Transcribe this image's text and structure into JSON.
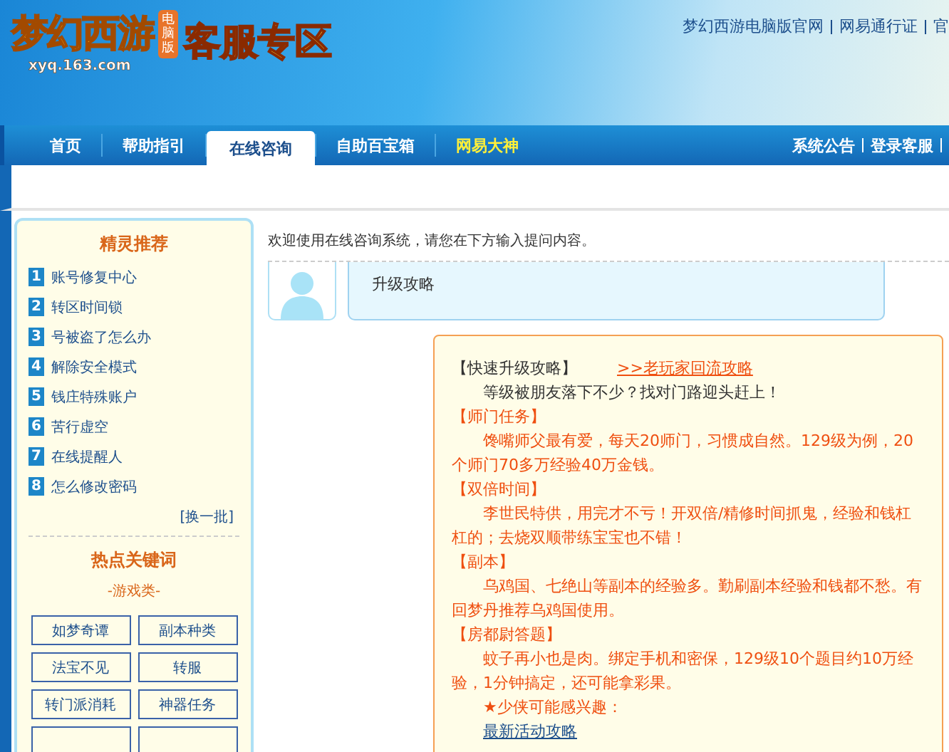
{
  "header": {
    "logo": {
      "name": "梦幻西游",
      "edition": "电脑版",
      "domain": "xyq.163.com"
    },
    "title": "客服专区",
    "links": [
      "梦幻西游电脑版官网",
      "网易通行证",
      "官"
    ]
  },
  "nav": {
    "tabs": [
      {
        "label": "首页",
        "selected": false,
        "kind": "normal"
      },
      {
        "label": "帮助指引",
        "selected": false,
        "kind": "normal"
      },
      {
        "label": "在线咨询",
        "selected": true,
        "kind": "normal"
      },
      {
        "label": "自助百宝箱",
        "selected": false,
        "kind": "normal"
      },
      {
        "label": "网易大神",
        "selected": false,
        "kind": "highlight"
      }
    ],
    "links": [
      "系统公告",
      "登录客服"
    ]
  },
  "sidebar": {
    "title": "精灵推荐",
    "items": [
      {
        "number": "1",
        "label": "账号修复中心"
      },
      {
        "number": "2",
        "label": "转区时间锁"
      },
      {
        "number": "3",
        "label": "号被盗了怎么办"
      },
      {
        "number": "4",
        "label": "解除安全模式"
      },
      {
        "number": "5",
        "label": "钱庄特殊账户"
      },
      {
        "number": "6",
        "label": "苦行虚空"
      },
      {
        "number": "7",
        "label": "在线提醒人"
      },
      {
        "number": "8",
        "label": "怎么修改密码"
      }
    ],
    "refresh": "[换一批]",
    "keywords_title": "热点关键词",
    "category": "-游戏类-",
    "keywords": [
      "如梦奇谭",
      "副本种类",
      "法宝不见",
      "转服",
      "转门派消耗",
      "神器任务"
    ]
  },
  "chat": {
    "welcome": "欢迎使用在线咨询系统，请您在下方输入提问内容。",
    "question": "升级攻略",
    "answer": {
      "sections": [
        {
          "kind": "intro",
          "title": "【快速升级攻略】",
          "link": ">>老玩家回流攻略",
          "text": "等级被朋友落下不少？找对门路迎头赶上！"
        },
        {
          "kind": "tip",
          "title": "【师门任务】",
          "text": "馋嘴师父最有爱，每天20师门，习惯成自然。129级为例，20个师门70多万经验40万金钱。"
        },
        {
          "kind": "tip",
          "title": "【双倍时间】",
          "text": "李世民特供，用完才不亏！开双倍/精修时间抓鬼，经验和钱杠杠的；去烧双顺带练宝宝也不错！"
        },
        {
          "kind": "tip",
          "title": "【副本】",
          "text": "乌鸡国、七绝山等副本的经验多。勤刷副本经验和钱都不愁。有回梦丹推荐乌鸡国使用。"
        },
        {
          "kind": "tip",
          "title": "【房都尉答题】",
          "text": "蚊子再小也是肉。绑定手机和密保，129级10个题目约10万经验，1分钟搞定，还可能拿彩果。"
        }
      ],
      "interest": "★少侠可能感兴趣：",
      "interest_link": "最新活动攻略"
    }
  }
}
